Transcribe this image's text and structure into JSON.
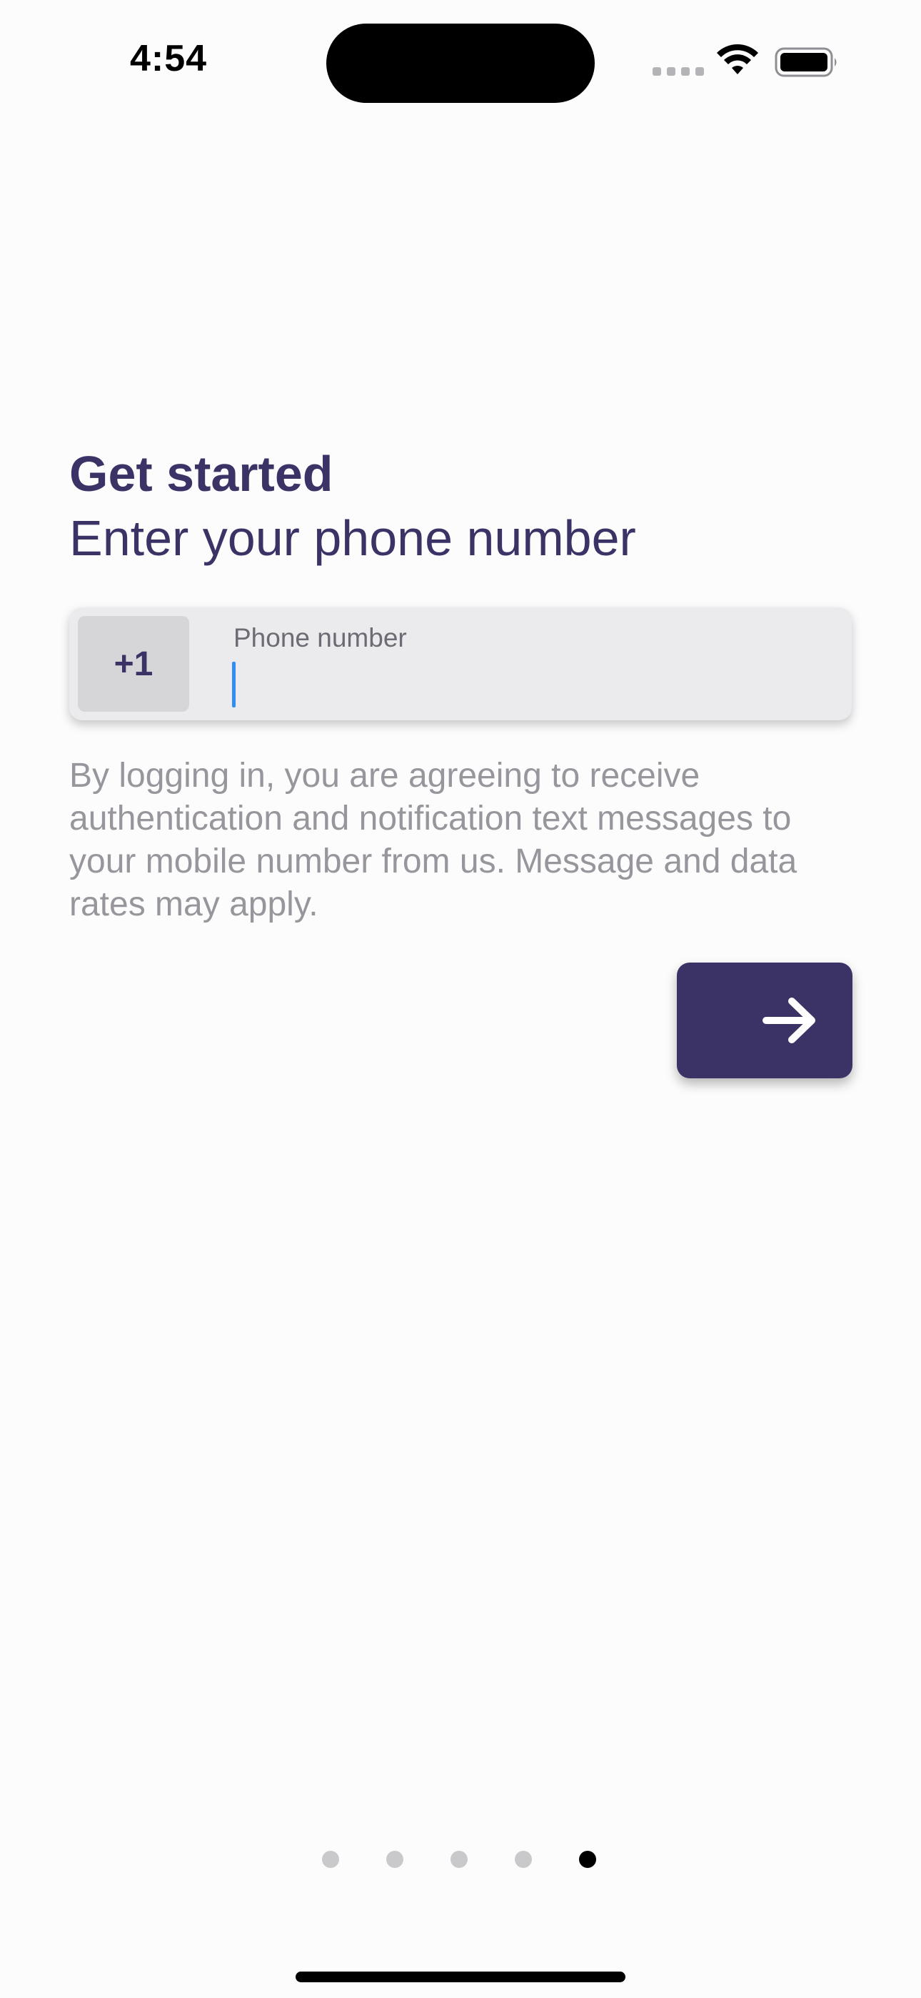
{
  "status_bar": {
    "time": "4:54",
    "icons": [
      "signal-icon",
      "wifi-icon",
      "battery-icon"
    ]
  },
  "header": {
    "title": "Get started",
    "subtitle": "Enter your phone number"
  },
  "phone_field": {
    "country_code": "+1",
    "label": "Phone number",
    "value": ""
  },
  "disclaimer": "By logging in, you are agreeing to receive authentication and notification text messages to your mobile number from us. Message and data rates may apply.",
  "next_button": {
    "icon": "arrow-right-icon"
  },
  "pagination": {
    "total": 5,
    "active_index": 4
  },
  "colors": {
    "accent": "#3b3366",
    "background": "#fdfcfd",
    "field_background": "#ebeaec",
    "caret": "#2f8ef0"
  }
}
